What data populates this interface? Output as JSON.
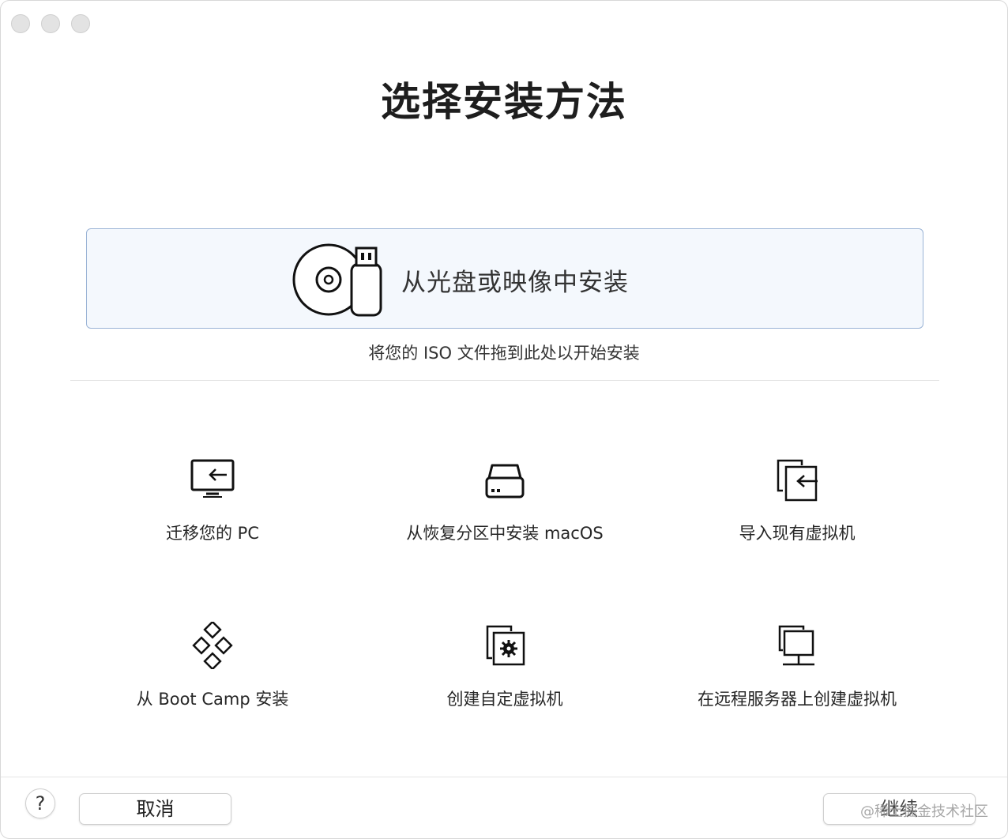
{
  "window": {
    "title": "选择安装方法"
  },
  "drop_zone": {
    "label": "从光盘或映像中安装",
    "hint": "将您的 ISO 文件拖到此处以开始安装"
  },
  "options": [
    {
      "label": "迁移您的 PC",
      "icon": "migrate-pc-icon"
    },
    {
      "label": "从恢复分区中安装 macOS",
      "icon": "hard-drive-icon"
    },
    {
      "label": "导入现有虚拟机",
      "icon": "import-vm-icon"
    },
    {
      "label": "从 Boot Camp 安装",
      "icon": "boot-camp-icon"
    },
    {
      "label": "创建自定虚拟机",
      "icon": "custom-vm-icon"
    },
    {
      "label": "在远程服务器上创建虚拟机",
      "icon": "remote-server-icon"
    }
  ],
  "footer": {
    "help_label": "?",
    "cancel_label": "取消",
    "continue_label": "继续"
  },
  "watermark": "@稀土掘金技术社区"
}
